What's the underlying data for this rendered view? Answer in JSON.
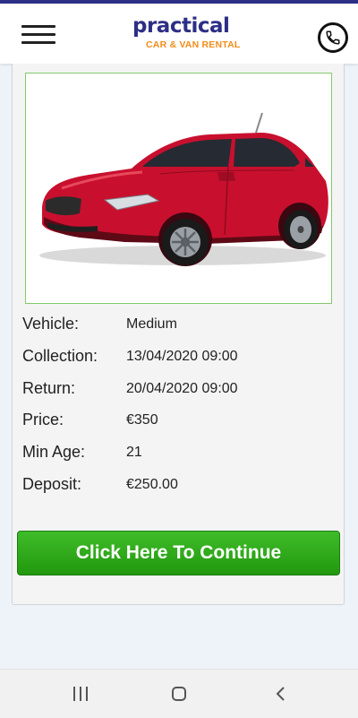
{
  "header": {
    "brand_main": "practical",
    "brand_sub": "CAR & VAN RENTAL",
    "menu_icon": "hamburger-menu-icon",
    "phone_icon": "phone-icon"
  },
  "vehicle_image": {
    "subject": "red hatchback car",
    "car_color": "#c8102e"
  },
  "details": [
    {
      "label": "Vehicle:",
      "value": "Medium"
    },
    {
      "label": "Collection:",
      "value": "13/04/2020 09:00"
    },
    {
      "label": "Return:",
      "value": "20/04/2020 09:00"
    },
    {
      "label": "Price:",
      "value": "€350"
    },
    {
      "label": "Min Age:",
      "value": "21"
    },
    {
      "label": "Deposit:",
      "value": "€250.00"
    }
  ],
  "continue_button": {
    "label": "Click Here To Continue",
    "color": "#2ca61a"
  },
  "colors": {
    "brand_blue": "#2d2f86",
    "brand_orange": "#f28c1a",
    "frame_green": "#84c96d"
  },
  "system_nav": {
    "recent_icon": "recent-apps-icon",
    "home_icon": "home-icon",
    "back_icon": "back-icon"
  }
}
